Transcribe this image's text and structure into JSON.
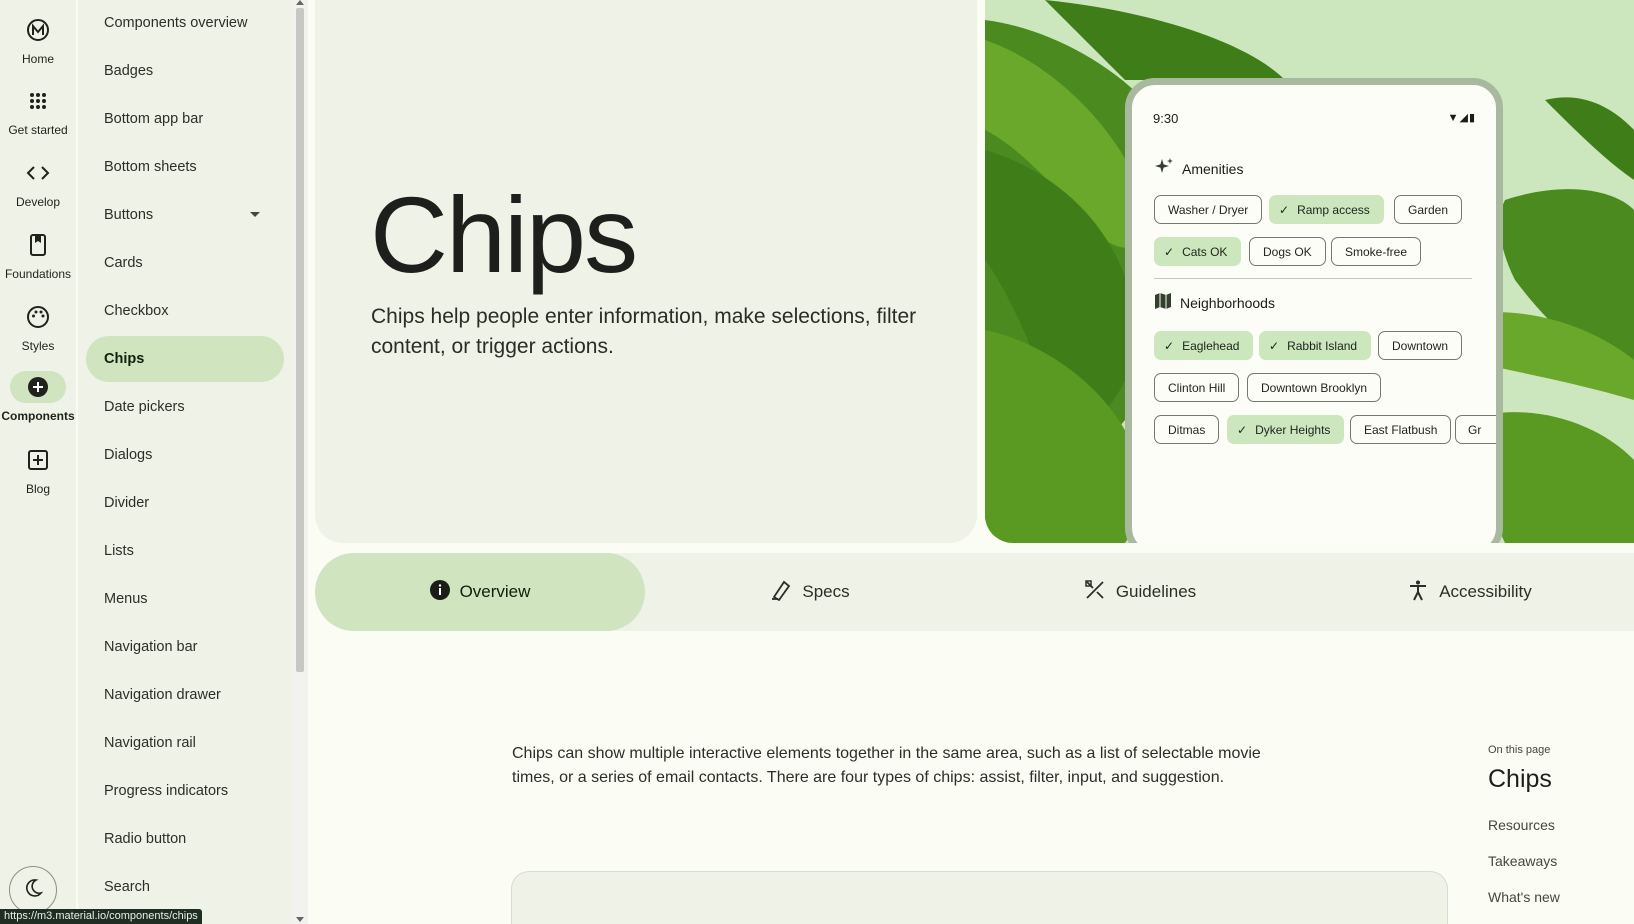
{
  "rail": {
    "items": [
      {
        "label": "Home",
        "icon": "material-logo-icon"
      },
      {
        "label": "Get started",
        "icon": "apps-grid-icon"
      },
      {
        "label": "Develop",
        "icon": "code-icon"
      },
      {
        "label": "Foundations",
        "icon": "bookmark-icon"
      },
      {
        "label": "Styles",
        "icon": "palette-icon"
      },
      {
        "label": "Components",
        "icon": "add-circle-icon",
        "active": true
      },
      {
        "label": "Blog",
        "icon": "add-box-icon"
      }
    ]
  },
  "nav": {
    "items": [
      "Components overview",
      "Badges",
      "Bottom app bar",
      "Bottom sheets",
      "Buttons",
      "Cards",
      "Checkbox",
      "Chips",
      "Date pickers",
      "Dialogs",
      "Divider",
      "Lists",
      "Menus",
      "Navigation bar",
      "Navigation drawer",
      "Navigation rail",
      "Progress indicators",
      "Radio button",
      "Search"
    ],
    "active": "Chips"
  },
  "status_url": "https://m3.material.io/components/chips",
  "hero": {
    "title": "Chips",
    "subtitle": "Chips help people enter information, make selections, filter content, or trigger actions."
  },
  "phone": {
    "time": "9:30",
    "amenities_title": "Amenities",
    "neighborhoods_title": "Neighborhoods",
    "amenity_chips": [
      {
        "label": "Washer / Dryer",
        "selected": false
      },
      {
        "label": "Ramp access",
        "selected": true
      },
      {
        "label": "Garden",
        "selected": false
      },
      {
        "label": "Cats OK",
        "selected": true
      },
      {
        "label": "Dogs OK",
        "selected": false
      },
      {
        "label": "Smoke-free",
        "selected": false
      }
    ],
    "neighborhood_chips": [
      {
        "label": "Eaglehead",
        "selected": true
      },
      {
        "label": "Rabbit Island",
        "selected": true
      },
      {
        "label": "Downtown",
        "selected": false
      },
      {
        "label": "Clinton Hill",
        "selected": false
      },
      {
        "label": "Downtown Brooklyn",
        "selected": false
      },
      {
        "label": "Ditmas",
        "selected": false
      },
      {
        "label": "Dyker Heights",
        "selected": true
      },
      {
        "label": "East Flatbush",
        "selected": false
      },
      {
        "label": "Gr",
        "selected": false
      }
    ]
  },
  "tabs": [
    {
      "label": "Overview",
      "icon": "info-icon",
      "active": true
    },
    {
      "label": "Specs",
      "icon": "specs-icon"
    },
    {
      "label": "Guidelines",
      "icon": "guidelines-icon"
    },
    {
      "label": "Accessibility",
      "icon": "accessibility-icon"
    }
  ],
  "intro": "Chips can show multiple interactive elements together in the same area, such as a list of selectable movie times, or a series of email contacts. There are four types of chips: assist, filter, input, and suggestion.",
  "on_this_page": {
    "label": "On this page",
    "title": "Chips",
    "links": [
      "Resources",
      "Takeaways",
      "What's new"
    ]
  },
  "colors": {
    "accent_container": "#cfe4bf",
    "surface": "#fbfcf3",
    "surface_container": "#eff2e6"
  }
}
